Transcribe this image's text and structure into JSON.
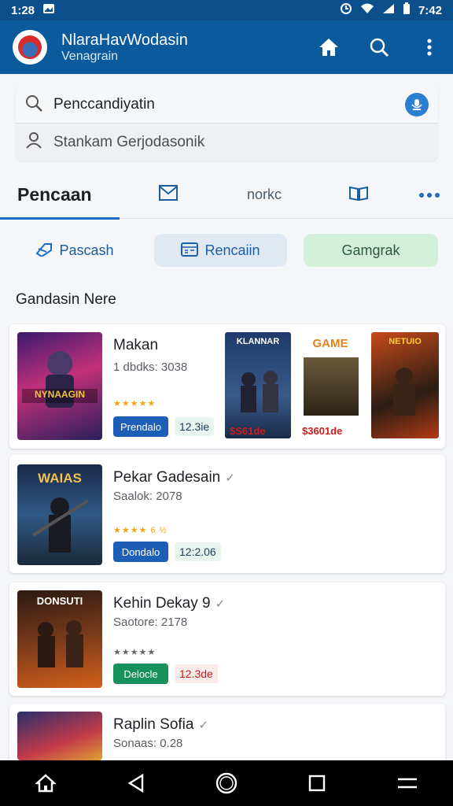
{
  "status": {
    "time_left": "1:28",
    "time_right": "7:42"
  },
  "app": {
    "title": "NlaraHavWodasin",
    "subtitle": "Venagrain"
  },
  "search": {
    "query": "Penccandiyatin",
    "suggestion": "Stankam Gerjodasonik"
  },
  "tabs": [
    {
      "label": "Pencaan"
    },
    {
      "icon": "mail-icon"
    },
    {
      "label": "norkc"
    },
    {
      "icon": "book-icon"
    },
    {
      "icon": "more-icon"
    }
  ],
  "chips": [
    {
      "label": "Pascash",
      "icon": "tag-icon"
    },
    {
      "label": "Rencaiin",
      "icon": "calendar-icon"
    },
    {
      "label": "Gamgrak"
    }
  ],
  "section_title": "Gandasin Nere",
  "items": [
    {
      "title": "Makan",
      "meta": "1 dbdks: 3038",
      "stars": "★★★★★",
      "button": "Prendalo",
      "price": "12.3ie",
      "button_color": "#1d5fb6",
      "price_color": "#1d3c5a",
      "price_bg": "#e8f5ee"
    },
    {
      "title": "Pekar Gadesain",
      "meta": "Saalok: 2078",
      "stars": "★★★★ 6 ½",
      "button": "Dondalo",
      "price": "12:2.06",
      "button_color": "#1d5fb6",
      "price_color": "#1d3c5a",
      "price_bg": "#e8f5ee"
    },
    {
      "title": "Kehin Dekay 9",
      "meta": "Saotore: 2178",
      "stars": "★★★★★",
      "button": "Delocle",
      "price": "12.3de",
      "button_color": "#18925a",
      "price_color": "#c41a1a",
      "price_bg": "#fbecec"
    },
    {
      "title": "Raplin Sofia",
      "meta": "Sonaas: 0.28"
    }
  ],
  "minis": [
    {
      "banner": "KLANNAR",
      "price": "$S61de"
    },
    {
      "banner": "GAME",
      "price": "$3601de"
    },
    {
      "banner": "NETUIO",
      "price": ""
    }
  ],
  "thumb_texts": [
    "NYNAAGIN",
    "WAIAS",
    "DONSUTI"
  ],
  "colors": {
    "primary": "#0b5a9c",
    "accent": "#1c6cc2"
  }
}
